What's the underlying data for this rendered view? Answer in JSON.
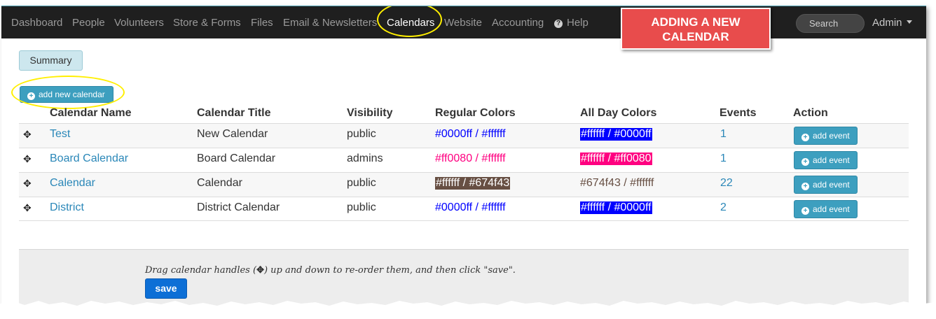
{
  "navbar": {
    "items": [
      "Dashboard",
      "People",
      "Volunteers",
      "Store & Forms",
      "Files",
      "Email & Newsletters",
      "Calendars",
      "Website",
      "Accounting"
    ],
    "help": "Help",
    "search_placeholder": "Search",
    "user": "Admin"
  },
  "callout": {
    "line1": "ADDING A NEW",
    "line2": "CALENDAR"
  },
  "summary_button": "Summary",
  "add_calendar_button": "add new calendar",
  "table": {
    "headers": [
      "Calendar Name",
      "Calendar Title",
      "Visibility",
      "Regular Colors",
      "All Day Colors",
      "Events",
      "Action"
    ],
    "rows": [
      {
        "name": "Test",
        "title": "New Calendar",
        "visibility": "public",
        "regular": "#0000ff / #ffffff",
        "allday": "#ffffff / #0000ff",
        "events": "1",
        "action": "add event"
      },
      {
        "name": "Board Calendar",
        "title": "Board Calendar",
        "visibility": "admins",
        "regular": "#ff0080 / #ffffff",
        "allday": "#ffffff / #ff0080",
        "events": "1",
        "action": "add event"
      },
      {
        "name": "Calendar",
        "title": "Calendar",
        "visibility": "public",
        "regular": "#ffffff / #674f43",
        "allday": "#674f43 / #ffffff",
        "events": "22",
        "action": "add event"
      },
      {
        "name": "District",
        "title": "District Calendar",
        "visibility": "public",
        "regular": "#0000ff / #ffffff",
        "allday": "#ffffff / #0000ff",
        "events": "2",
        "action": "add event"
      }
    ]
  },
  "footer": {
    "note_before": "Drag calendar handles (",
    "note_after": ") up and down to re-order them, and then click \"save\".",
    "save": "save"
  },
  "colors": {
    "navbar_bg": "#1f1f1f",
    "callout": "#e84c4c",
    "button_primary": "#3d9fbf",
    "save_button": "#0d6fd6",
    "link": "#2a87b8",
    "highlight_ring": "#ffef00"
  },
  "icons": [
    "plus-circle-icon",
    "move-handle-icon",
    "help-circle-icon",
    "caret-down-icon"
  ]
}
